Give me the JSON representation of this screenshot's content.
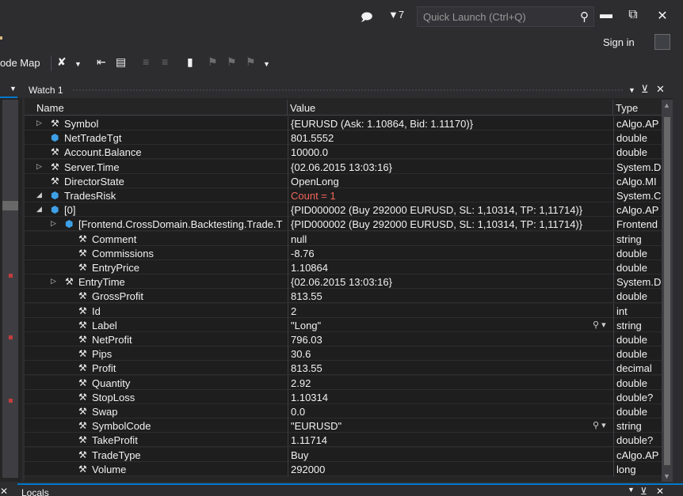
{
  "topbar": {
    "notify_icon": "speech-bubble-icon",
    "filter_count": "7",
    "quick_launch_placeholder": "Quick Launch (Ctrl+Q)",
    "sign_in": "Sign in"
  },
  "toolbar": {
    "code_map": "ode Map"
  },
  "watch": {
    "title": "Watch 1",
    "columns": {
      "name": "Name",
      "value": "Value",
      "type": "Type"
    },
    "rows": [
      {
        "name": "Symbol",
        "value": "{EURUSD (Ask: 1.10864, Bid: 1.11170)}",
        "type": "cAlgo.AP",
        "indent": 0,
        "expander": "collapsed",
        "icon": "wrench"
      },
      {
        "name": "NetTradeTgt",
        "value": "801.5552",
        "type": "double",
        "indent": 1,
        "expander": "none",
        "icon": "field"
      },
      {
        "name": "Account.Balance",
        "value": "10000.0",
        "type": "double",
        "indent": 1,
        "expander": "none",
        "icon": "wrench"
      },
      {
        "name": "Server.Time",
        "value": "{02.06.2015 13:03:16}",
        "type": "System.D",
        "indent": 0,
        "expander": "collapsed",
        "icon": "wrench"
      },
      {
        "name": "DirectorState",
        "value": "OpenLong",
        "type": "cAlgo.MI",
        "indent": 1,
        "expander": "none",
        "icon": "wrench-lock"
      },
      {
        "name": "TradesRisk",
        "value": "Count = 1",
        "type": "System.C",
        "indent": 0,
        "expander": "expanded",
        "icon": "field-lock",
        "value_changed": true
      },
      {
        "name": "[0]",
        "value": "{PID000002 (Buy 292000 EURUSD, SL: 1,10314, TP: 1,11714)}",
        "type": "cAlgo.AP",
        "indent": 1,
        "expander": "expanded",
        "icon": "field"
      },
      {
        "name": "[Frontend.CrossDomain.Backtesting.Trade.T",
        "value": "{PID000002 (Buy 292000 EURUSD, SL: 1,10314, TP: 1,11714)}",
        "type": "Frontend",
        "indent": 2,
        "expander": "collapsed",
        "icon": "field"
      },
      {
        "name": "Comment",
        "value": "null",
        "type": "string",
        "indent": 3,
        "expander": "none",
        "icon": "wrench"
      },
      {
        "name": "Commissions",
        "value": "-8.76",
        "type": "double",
        "indent": 3,
        "expander": "none",
        "icon": "wrench"
      },
      {
        "name": "EntryPrice",
        "value": "1.10864",
        "type": "double",
        "indent": 3,
        "expander": "none",
        "icon": "wrench"
      },
      {
        "name": "EntryTime",
        "value": "{02.06.2015 13:03:16}",
        "type": "System.D",
        "indent": 2,
        "expander": "collapsed",
        "icon": "wrench"
      },
      {
        "name": "GrossProfit",
        "value": "813.55",
        "type": "double",
        "indent": 3,
        "expander": "none",
        "icon": "wrench"
      },
      {
        "name": "Id",
        "value": "2",
        "type": "int",
        "indent": 3,
        "expander": "none",
        "icon": "wrench"
      },
      {
        "name": "Label",
        "value": "\"Long\"",
        "type": "string",
        "indent": 3,
        "expander": "none",
        "icon": "wrench",
        "visualizer": true
      },
      {
        "name": "NetProfit",
        "value": "796.03",
        "type": "double",
        "indent": 3,
        "expander": "none",
        "icon": "wrench"
      },
      {
        "name": "Pips",
        "value": "30.6",
        "type": "double",
        "indent": 3,
        "expander": "none",
        "icon": "wrench"
      },
      {
        "name": "Profit",
        "value": "813.55",
        "type": "decimal",
        "indent": 3,
        "expander": "none",
        "icon": "wrench"
      },
      {
        "name": "Quantity",
        "value": "2.92",
        "type": "double",
        "indent": 3,
        "expander": "none",
        "icon": "wrench"
      },
      {
        "name": "StopLoss",
        "value": "1.10314",
        "type": "double?",
        "indent": 3,
        "expander": "none",
        "icon": "wrench"
      },
      {
        "name": "Swap",
        "value": "0.0",
        "type": "double",
        "indent": 3,
        "expander": "none",
        "icon": "wrench"
      },
      {
        "name": "SymbolCode",
        "value": "\"EURUSD\"",
        "type": "string",
        "indent": 3,
        "expander": "none",
        "icon": "wrench",
        "visualizer": true
      },
      {
        "name": "TakeProfit",
        "value": "1.11714",
        "type": "double?",
        "indent": 3,
        "expander": "none",
        "icon": "wrench"
      },
      {
        "name": "TradeType",
        "value": "Buy",
        "type": "cAlgo.AP",
        "indent": 3,
        "expander": "none",
        "icon": "wrench"
      },
      {
        "name": "Volume",
        "value": "292000",
        "type": "long",
        "indent": 3,
        "expander": "none",
        "icon": "wrench"
      }
    ]
  },
  "bottom_panel": {
    "title": "Locals"
  },
  "colors": {
    "accent": "#007acc",
    "changed_value": "#f1665b",
    "field_icon": "#3ea0e6"
  }
}
